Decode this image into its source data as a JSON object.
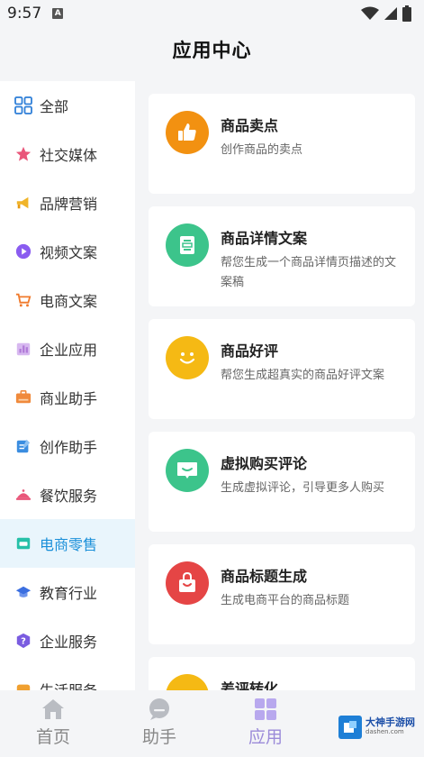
{
  "status": {
    "time": "9:57",
    "badge": "A"
  },
  "page": {
    "title": "应用中心"
  },
  "sidebar": {
    "items": [
      {
        "label": "全部",
        "icon": "grid-icon",
        "color": "#2f7fd8"
      },
      {
        "label": "社交媒体",
        "icon": "star-icon",
        "color": "#e9567a"
      },
      {
        "label": "品牌营销",
        "icon": "megaphone-icon",
        "color": "#f0b429"
      },
      {
        "label": "视频文案",
        "icon": "play-icon",
        "color": "#8a5cf0"
      },
      {
        "label": "电商文案",
        "icon": "cart-icon",
        "color": "#f07a2c"
      },
      {
        "label": "企业应用",
        "icon": "chart-icon",
        "color": "#b07ad8"
      },
      {
        "label": "商业助手",
        "icon": "briefcase-icon",
        "color": "#f08a3c"
      },
      {
        "label": "创作助手",
        "icon": "edit-icon",
        "color": "#3b8de0"
      },
      {
        "label": "餐饮服务",
        "icon": "dish-icon",
        "color": "#e9567a"
      },
      {
        "label": "电商零售",
        "icon": "store-icon",
        "color": "#26c0a8"
      },
      {
        "label": "教育行业",
        "icon": "graduation-cap-icon",
        "color": "#3b6fe0"
      },
      {
        "label": "企业服务",
        "icon": "help-icon",
        "color": "#7a5ce0"
      },
      {
        "label": "生活服务",
        "icon": "life-icon",
        "color": "#f0a030"
      }
    ],
    "active_index": 9
  },
  "cards": [
    {
      "title": "商品卖点",
      "desc": "创作商品的卖点",
      "icon": "thumbs-up-icon",
      "color": "#f29111"
    },
    {
      "title": "商品详情文案",
      "desc": "帮您生成一个商品详情页描述的文案稿",
      "icon": "document-icon",
      "color": "#3cc48b"
    },
    {
      "title": "商品好评",
      "desc": "帮您生成超真实的商品好评文案",
      "icon": "smile-icon",
      "color": "#f5b914"
    },
    {
      "title": "虚拟购买评论",
      "desc": "生成虚拟评论，引导更多人购买",
      "icon": "chat-bubble-icon",
      "color": "#3cc48b"
    },
    {
      "title": "商品标题生成",
      "desc": "生成电商平台的商品标题",
      "icon": "shopping-bag-icon",
      "color": "#e54545"
    },
    {
      "title": "差评转化",
      "desc": "",
      "icon": "partial-icon",
      "color": "#f5b914"
    }
  ],
  "tabbar": {
    "tabs": [
      {
        "label": "首页",
        "icon": "home-icon"
      },
      {
        "label": "助手",
        "icon": "assistant-icon"
      },
      {
        "label": "应用",
        "icon": "apps-grid-icon"
      }
    ],
    "active_index": 2
  },
  "watermark": {
    "main": "大神手游网",
    "sub": "dashen.com"
  }
}
